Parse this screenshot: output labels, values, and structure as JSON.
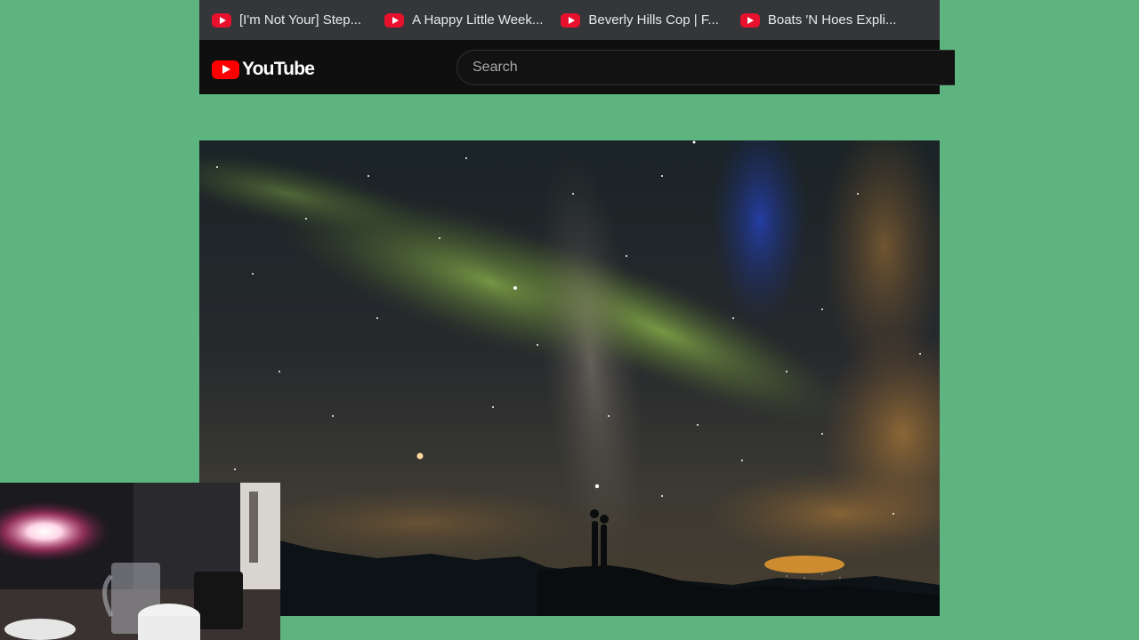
{
  "bookmarks": [
    {
      "label": "[I'm Not Your] Step...",
      "icon": "youtube-icon"
    },
    {
      "label": "A Happy Little Week...",
      "icon": "youtube-icon"
    },
    {
      "label": "Beverly Hills Cop | F...",
      "icon": "youtube-icon"
    },
    {
      "label": "Boats 'N Hoes Expli...",
      "icon": "youtube-icon"
    }
  ],
  "header": {
    "logo_text": "YouTube",
    "logo_icon": "youtube-play-icon",
    "search_placeholder": "Search"
  },
  "colors": {
    "page_background": "#5db47f",
    "bookmark_bar": "#35363a",
    "header": "#0f0f0f",
    "youtube_red": "#ff0000"
  },
  "content": {
    "photo": "night sky with aurora and milky way, two people silhouetted on a ridge",
    "webcam": "webcam overlay showing a lamp and a glass mug on a desk"
  }
}
